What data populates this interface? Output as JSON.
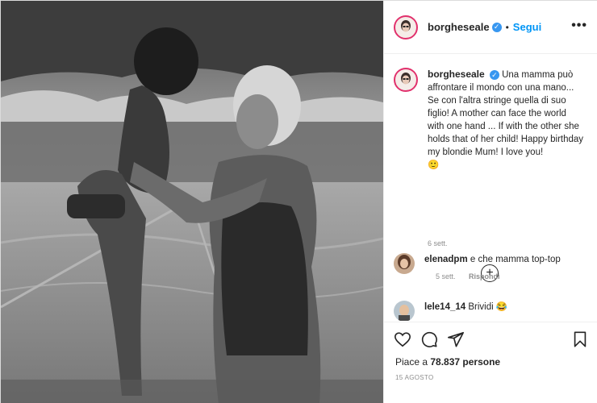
{
  "post": {
    "username": "borgheseale",
    "verified_mark": "✓",
    "separator": "•",
    "follow_label": "Segui",
    "more_label": "•••",
    "caption": "Una mamma può affrontare il mondo con una mano... Se con l'altra stringe quella di suo figlio! A mother can face the world with one hand ... If with the other she holds that of her child! Happy birthday my blondie Mum! I love you!",
    "caption_emoji": "🙂",
    "caption_time": "6 sett.",
    "load_more_label": "+",
    "comments": [
      {
        "username": "elenadpm",
        "text": "e che mamma top-top",
        "time": "5 sett.",
        "reply_label": "Rispondi"
      },
      {
        "username": "lele14_14",
        "text": "Brividi 😂"
      }
    ],
    "likes_prefix": "Piace a",
    "likes_count": "78.837",
    "likes_suffix": "persone",
    "date": "15 AGOSTO"
  },
  "icons": [
    "heart-icon",
    "comment-icon",
    "share-icon",
    "bookmark-icon",
    "more-options-icon",
    "verified-badge-icon",
    "load-more-icon"
  ],
  "colors": {
    "accent": "#0095f6",
    "verified": "#3897f0",
    "muted": "#8e8e8e",
    "border": "#dbdbdb"
  }
}
